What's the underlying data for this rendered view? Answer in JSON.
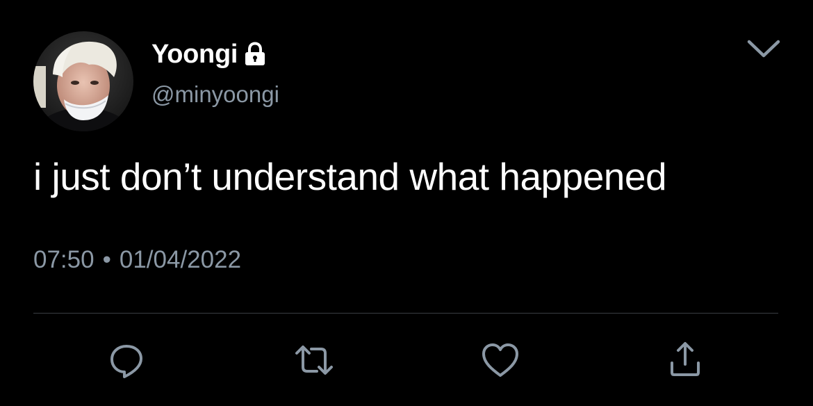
{
  "user": {
    "display_name": "Yoongi",
    "handle": "@minyoongi",
    "locked_icon": "lock-icon",
    "avatar": "profile-photo"
  },
  "tweet": {
    "text": "i just don’t understand what happened",
    "time": "07:50",
    "separator": "•",
    "date": "01/04/2022"
  },
  "menu_icon": "chevron-down-icon",
  "actions": [
    {
      "icon": "reply-icon"
    },
    {
      "icon": "retweet-icon"
    },
    {
      "icon": "like-icon"
    },
    {
      "icon": "share-icon"
    }
  ],
  "colors": {
    "background": "#000000",
    "primary_text": "#ffffff",
    "secondary_text": "#8b98a5",
    "divider": "#3a3f44"
  }
}
